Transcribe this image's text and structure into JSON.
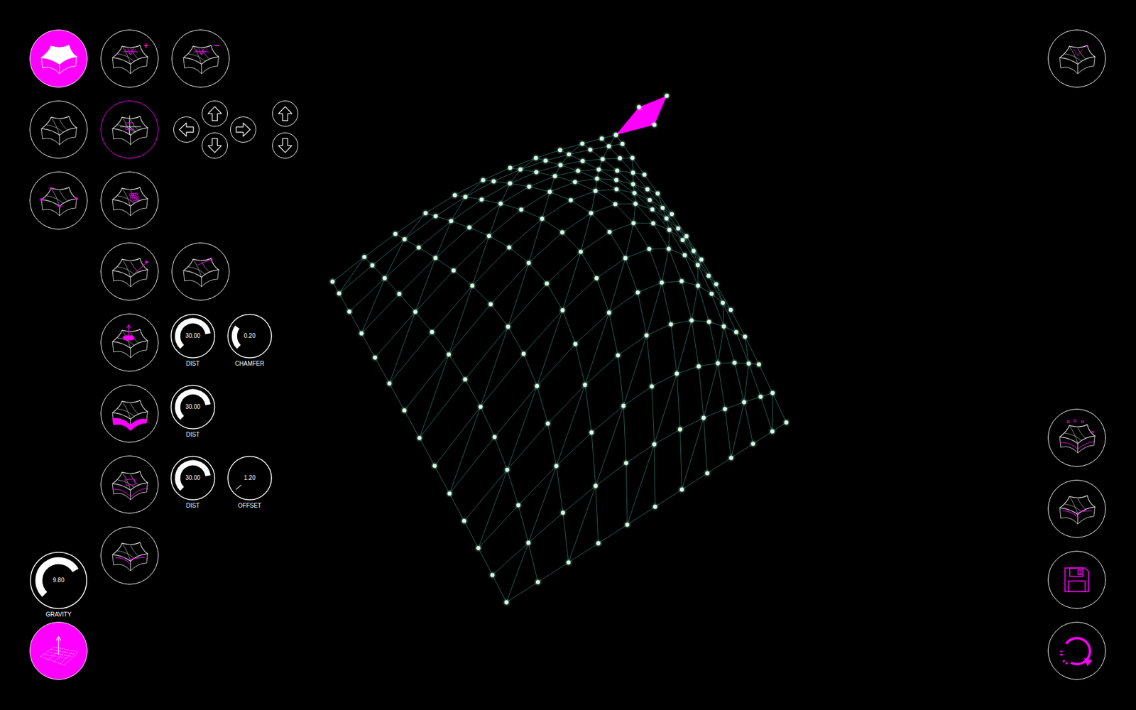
{
  "left_toolbar": {
    "tool_buttons": [
      {
        "selected": true,
        "highlighted": false,
        "badge": ""
      },
      {
        "selected": false,
        "highlighted": false,
        "badge": ""
      },
      {
        "selected": false,
        "highlighted": false,
        "badge": ""
      },
      {
        "selected": false,
        "highlighted": false,
        "badge": "+"
      },
      {
        "selected": false,
        "highlighted": false,
        "badge": "−"
      },
      {
        "selected": false,
        "highlighted": true,
        "badge": ""
      },
      {
        "selected": false,
        "highlighted": false,
        "badge": ""
      },
      {
        "selected": false,
        "highlighted": false,
        "badge": ""
      },
      {
        "selected": false,
        "highlighted": false,
        "badge": ""
      },
      {
        "selected": false,
        "highlighted": false,
        "badge": ""
      },
      {
        "selected": false,
        "highlighted": false,
        "badge": ""
      },
      {
        "selected": false,
        "highlighted": false,
        "badge": ""
      },
      {
        "selected": false,
        "highlighted": false,
        "badge": ""
      },
      {
        "selected": true,
        "highlighted": false,
        "badge": ""
      }
    ],
    "knobs": [
      {
        "value": "30.00",
        "label": "DIST",
        "level": 0.8
      },
      {
        "value": "0.20",
        "label": "CHAMFER",
        "level": 0.3
      },
      {
        "value": "30.00",
        "label": "DIST",
        "level": 0.8
      },
      {
        "value": "30.00",
        "label": "DIST",
        "level": 0.8
      },
      {
        "value": "1.20",
        "label": "OFFSET",
        "level": 0.02
      }
    ],
    "gravity": {
      "value": "9.80",
      "label": "GRAVITY",
      "level": 0.72
    }
  },
  "viewport": {
    "selected_face": true
  }
}
